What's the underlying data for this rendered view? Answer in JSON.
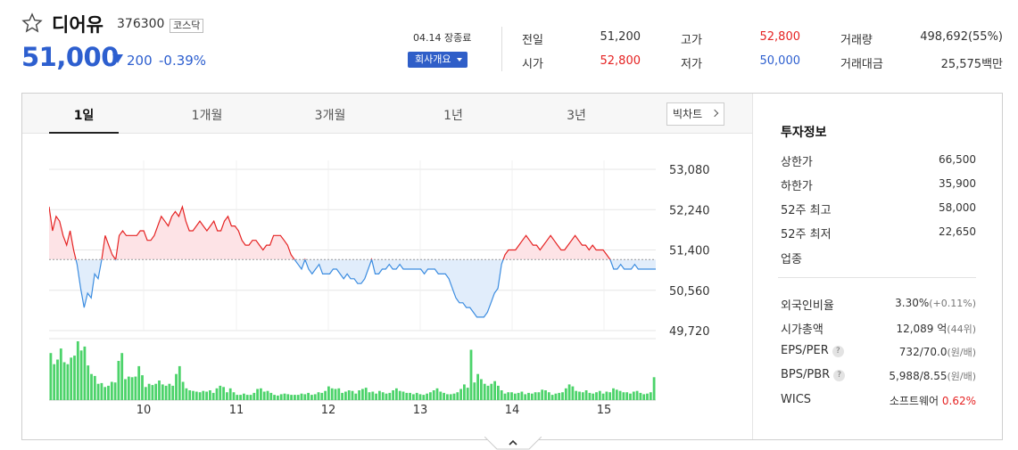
{
  "header": {
    "name": "디어유",
    "code": "376300",
    "market": "코스닥",
    "price": "51,000",
    "change": "200",
    "change_pct": "-0.39%",
    "close_status": "04.14 장종료",
    "company_button": "회사개요"
  },
  "quote": {
    "prev_close_label": "전일",
    "prev_close": "51,200",
    "open_label": "시가",
    "open": "52,800",
    "high_label": "고가",
    "high": "52,800",
    "low_label": "저가",
    "low": "50,000",
    "volume_label": "거래량",
    "volume": "498,692(55%)",
    "amount_label": "거래대금",
    "amount": "25,575백만"
  },
  "tabs": [
    "1일",
    "1개월",
    "3개월",
    "1년",
    "3년"
  ],
  "active_tab": "1일",
  "big_chart_label": "빅차트",
  "invest": {
    "title": "투자정보",
    "upper_limit_label": "상한가",
    "upper_limit": "66,500",
    "lower_limit_label": "하한가",
    "lower_limit": "35,900",
    "high52_label": "52주 최고",
    "high52": "58,000",
    "low52_label": "52주 최저",
    "low52": "22,650",
    "industry_label": "업종",
    "foreign_label": "외국인비율",
    "foreign": "3.30%",
    "foreign_sub": "(+0.11%)",
    "mcap_label": "시가총액",
    "mcap": "12,089 억",
    "mcap_sub": "(44위)",
    "eps_label": "EPS/PER",
    "eps": "732/70.0",
    "eps_sub": "(원/배)",
    "bps_label": "BPS/PBR",
    "bps": "5,988/8.55",
    "bps_sub": "(원/배)",
    "wics_label": "WICS",
    "wics": "소프트웨어",
    "wics_pct": "0.62%"
  },
  "colors": {
    "up": "#e52222",
    "down": "#2d5fcf",
    "volume": "#4cd36a",
    "accent": "#2f5ec8"
  },
  "chart_data": {
    "type": "line",
    "y_ticks": [
      "53,080",
      "52,240",
      "51,400",
      "50,560",
      "49,720"
    ],
    "x_ticks": [
      "10",
      "11",
      "12",
      "13",
      "14",
      "15"
    ],
    "ylim": [
      49720,
      53080
    ],
    "baseline": 51200,
    "values": [
      52300,
      51800,
      52100,
      52000,
      51700,
      51500,
      51800,
      51400,
      51100,
      50600,
      50200,
      50500,
      50400,
      50900,
      50800,
      51200,
      51700,
      51500,
      51300,
      51200,
      51700,
      51800,
      51700,
      51700,
      51700,
      51700,
      51800,
      51800,
      51600,
      51600,
      51700,
      51900,
      52100,
      52000,
      51900,
      52100,
      52200,
      52100,
      52300,
      52000,
      51800,
      51800,
      51900,
      52000,
      51900,
      51800,
      51900,
      52000,
      51800,
      51800,
      52000,
      52100,
      51900,
      51900,
      51800,
      51600,
      51500,
      51500,
      51600,
      51600,
      51500,
      51400,
      51500,
      51500,
      51700,
      51700,
      51700,
      51600,
      51500,
      51300,
      51200,
      51100,
      51000,
      51200,
      51000,
      50900,
      51000,
      51100,
      50900,
      50900,
      50900,
      51000,
      51000,
      50900,
      50800,
      50900,
      50800,
      50800,
      50700,
      50700,
      50800,
      51000,
      51200,
      50900,
      50900,
      51000,
      51000,
      51100,
      51000,
      51000,
      51100,
      51000,
      51000,
      51000,
      51000,
      51000,
      51000,
      50900,
      51000,
      51000,
      51000,
      50900,
      50900,
      50900,
      50800,
      50600,
      50400,
      50300,
      50300,
      50200,
      50200,
      50100,
      50000,
      50000,
      50000,
      50100,
      50300,
      50500,
      50600,
      51100,
      51300,
      51400,
      51400,
      51400,
      51500,
      51600,
      51700,
      51600,
      51500,
      51500,
      51400,
      51500,
      51600,
      51700,
      51600,
      51500,
      51400,
      51400,
      51500,
      51600,
      51700,
      51600,
      51500,
      51500,
      51400,
      51500,
      51400,
      51400,
      51400,
      51300,
      51200,
      51000,
      51000,
      51100,
      51000,
      51000,
      51000,
      51100,
      51000,
      51000,
      51000,
      51000,
      51000,
      51000
    ],
    "volume": [
      72,
      55,
      62,
      79,
      58,
      55,
      65,
      68,
      90,
      76,
      82,
      53,
      40,
      37,
      25,
      26,
      20,
      22,
      28,
      27,
      60,
      72,
      32,
      36,
      35,
      36,
      52,
      38,
      20,
      25,
      23,
      25,
      30,
      24,
      22,
      25,
      22,
      40,
      52,
      28,
      18,
      15,
      14,
      13,
      12,
      14,
      13,
      15,
      11,
      18,
      22,
      20,
      12,
      18,
      12,
      8,
      8,
      10,
      8,
      8,
      11,
      17,
      18,
      13,
      14,
      11,
      8,
      7,
      9,
      10,
      9,
      8,
      8,
      8,
      10,
      9,
      11,
      8,
      9,
      12,
      11,
      14,
      21,
      18,
      17,
      18,
      11,
      13,
      15,
      14,
      10,
      15,
      17,
      19,
      12,
      13,
      10,
      14,
      12,
      10,
      11,
      15,
      18,
      14,
      13,
      11,
      11,
      9,
      11,
      9,
      8,
      10,
      12,
      15,
      18,
      13,
      11,
      9,
      9,
      10,
      12,
      17,
      24,
      19,
      77,
      27,
      40,
      32,
      25,
      22,
      25,
      29,
      22,
      15,
      10,
      12,
      12,
      10,
      11,
      13,
      9,
      11,
      10,
      12,
      12,
      16,
      15,
      12,
      8,
      10,
      11,
      12,
      18,
      24,
      21,
      14,
      13,
      12,
      15,
      11,
      10,
      12,
      14,
      10,
      13,
      12,
      18,
      16,
      14,
      12,
      12,
      10,
      13,
      14,
      11,
      9,
      10,
      12,
      35
    ]
  }
}
